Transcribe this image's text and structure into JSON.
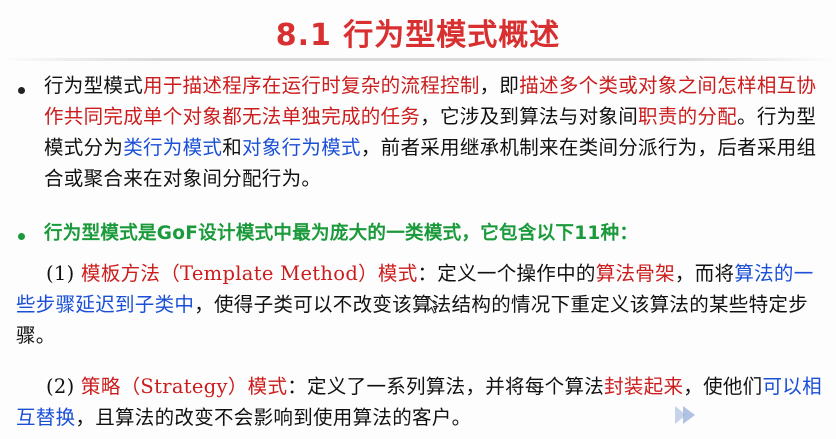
{
  "slide": {
    "title": "8.1 行为型模式概述",
    "p1": {
      "s1": "行为型模式",
      "s2": "用于描述程序在运行时复杂的流程控制",
      "s3": "，即",
      "s4": "描述多个类或对象之间怎样相互协作共同完成单个对象都无法单独完成的任务",
      "s5": "，它涉及到算法与对象间",
      "s6": "职责的分配",
      "s7": "。行为型模式分为",
      "s8": "类行为模式",
      "s9": "和",
      "s10": "对象行为模式",
      "s11": "，前者采用继承机制来在类间分派行为，后者采用组合或聚合来在对象间分配行为。"
    },
    "p2": "行为型模式是GoF设计模式中最为庞大的一类模式，它包含以下11种：",
    "p3": {
      "num": "(1) ",
      "s1": "模板方法（Template Method）模式",
      "s2": "：定义一个操作中的",
      "s3": "算法骨架",
      "s4": "，而将",
      "s5": "算法的一些步骤延迟到子类中",
      "s6": "，使得子类可以不改变该算法结构的情况下重定义该算法的某些特定步骤。"
    },
    "p4": {
      "num": "(2) ",
      "s1": "策略（Strategy）模式",
      "s2": "：定义了一系列算法，并将每个算法",
      "s3": "封装起来",
      "s4": "，使他们",
      "s5": "可以相互替换",
      "s6": "，且算法的改变不会影响到使用算法的客户。"
    }
  },
  "colors": {
    "title": "#d83030",
    "emphasis_red": "#cc1c1c",
    "emphasis_blue": "#1a4fd6",
    "green": "#1a9a3a",
    "text": "#111111"
  },
  "icons": {
    "cursor": "mouse-pointer-icon",
    "logo": "player-logo-icon"
  }
}
